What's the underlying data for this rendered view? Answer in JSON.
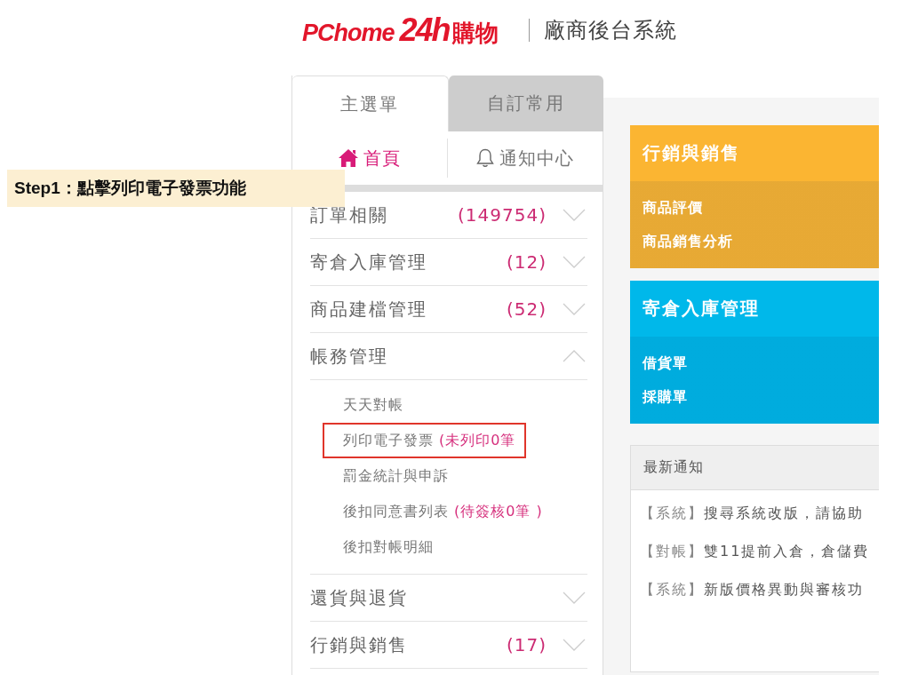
{
  "header": {
    "logo": {
      "brand": "PChome",
      "mark": "24h",
      "suffix": "購物"
    },
    "system_title": "廠商後台系統"
  },
  "annotation": {
    "text": "Step1：點擊列印電子發票功能"
  },
  "sidebar": {
    "tabs": [
      {
        "label": "主選單",
        "selected": true
      },
      {
        "label": "自訂常用",
        "selected": false
      }
    ],
    "nav": [
      {
        "label": "首頁",
        "kind": "home",
        "selected": true
      },
      {
        "label": "通知中心",
        "kind": "notifications",
        "selected": false
      }
    ],
    "menu": [
      {
        "label": "訂單相關",
        "count": "(149754)",
        "expanded": false
      },
      {
        "label": "寄倉入庫管理",
        "count": "(12)",
        "expanded": false
      },
      {
        "label": "商品建檔管理",
        "count": "(52)",
        "expanded": false
      },
      {
        "label": "帳務管理",
        "expanded": true,
        "children": [
          {
            "label": "天天對帳",
            "highlighted": false
          },
          {
            "label": "列印電子發票",
            "count": "(未列印0筆",
            "highlighted": true
          },
          {
            "label": "罰金統計與申訴",
            "highlighted": false
          },
          {
            "label": "後扣同意書列表",
            "count": "(待簽核0筆 )",
            "highlighted": false
          },
          {
            "label": "後扣對帳明細",
            "highlighted": false
          }
        ]
      },
      {
        "label": "還貨與退貨",
        "expanded": false
      },
      {
        "label": "行銷與銷售",
        "count": "(17)",
        "expanded": false
      }
    ]
  },
  "content": {
    "cards": [
      {
        "title": "行銷與銷售",
        "color": "#fbb532",
        "links": [
          "商品評價",
          "商品銷售分析"
        ]
      },
      {
        "title": "寄倉入庫管理",
        "color": "#00b8ea",
        "links": [
          "借貨單",
          "採購單"
        ]
      }
    ],
    "notices": {
      "title": "最新通知",
      "items": [
        {
          "tag": "【系統】",
          "text": "搜尋系統改版，請協助"
        },
        {
          "tag": "【對帳】",
          "text": "雙11提前入倉，倉儲費"
        },
        {
          "tag": "【系統】",
          "text": "新版價格異動與審核功"
        }
      ]
    }
  }
}
